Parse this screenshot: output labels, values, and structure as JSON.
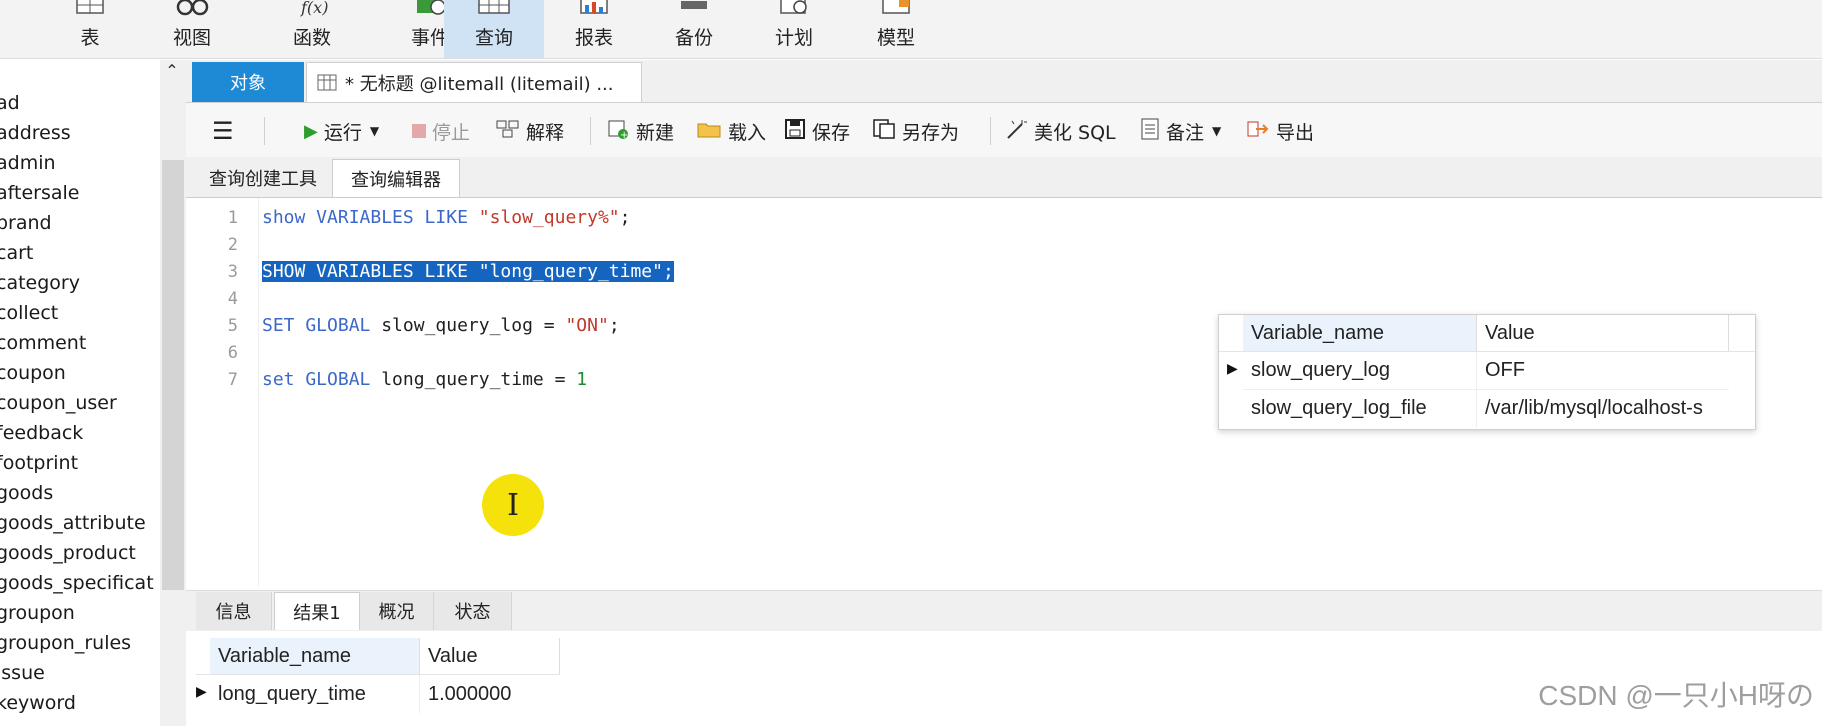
{
  "ribbon": {
    "buttons": [
      {
        "label": "表",
        "icon": "table-icon",
        "active": false
      },
      {
        "label": "视图",
        "icon": "view-glasses-icon",
        "active": false
      },
      {
        "label": "函数",
        "icon": "function-icon",
        "active": false
      },
      {
        "label": "事件",
        "icon": "event-clock-icon",
        "active": false
      },
      {
        "label": "查询",
        "icon": "query-grid-icon",
        "active": true
      },
      {
        "label": "报表",
        "icon": "report-icon",
        "active": false
      },
      {
        "label": "备份",
        "icon": "backup-icon",
        "active": false
      },
      {
        "label": "计划",
        "icon": "schedule-icon",
        "active": false
      },
      {
        "label": "模型",
        "icon": "model-icon",
        "active": false
      }
    ]
  },
  "object_tree": {
    "items": [
      "ad",
      "address",
      "admin",
      "aftersale",
      "brand",
      "cart",
      "category",
      "collect",
      "comment",
      "coupon",
      "coupon_user",
      "feedback",
      "footprint",
      "goods",
      "goods_attribute",
      "goods_product",
      "goods_specificat",
      "groupon",
      "groupon_rules",
      "issue",
      "keyword"
    ]
  },
  "tabs": {
    "objects_label": "对象",
    "query_tab_label": "* 无标题 @litemall (litemail) ..."
  },
  "toolbar": {
    "menu_icon": "hamburger-menu-icon",
    "run_label": "运行",
    "stop_label": "停止",
    "explain_label": "解释",
    "new_label": "新建",
    "load_label": "载入",
    "save_label": "保存",
    "save_as_label": "另存为",
    "beautify_label": "美化 SQL",
    "comment_label": "备注",
    "export_label": "导出"
  },
  "subtabs": {
    "builder_label": "查询创建工具",
    "editor_label": "查询编辑器"
  },
  "editor": {
    "line_numbers": [
      "1",
      "2",
      "3",
      "4",
      "5",
      "6",
      "7"
    ]
  },
  "popup_result": {
    "headers": [
      "Variable_name",
      "Value"
    ],
    "rows": [
      [
        "slow_query_log",
        "OFF"
      ],
      [
        "slow_query_log_file",
        "/var/lib/mysql/localhost-s"
      ]
    ]
  },
  "cursor_glyph": "I",
  "result_tabs": {
    "tabs": [
      "信息",
      "结果1",
      "概况",
      "状态"
    ],
    "active_index": 1
  },
  "result_grid": {
    "headers": [
      "Variable_name",
      "Value"
    ],
    "rows": [
      [
        "long_query_time",
        "1.000000"
      ]
    ]
  },
  "watermark": "CSDN @一只小H呀の",
  "colors": {
    "accent": "#1e8ad6",
    "selection": "#1565c0",
    "keyword": "#3c68c9",
    "string": "#c0392b",
    "number": "#1f8a33",
    "cursor_badge": "#f5e20a"
  }
}
